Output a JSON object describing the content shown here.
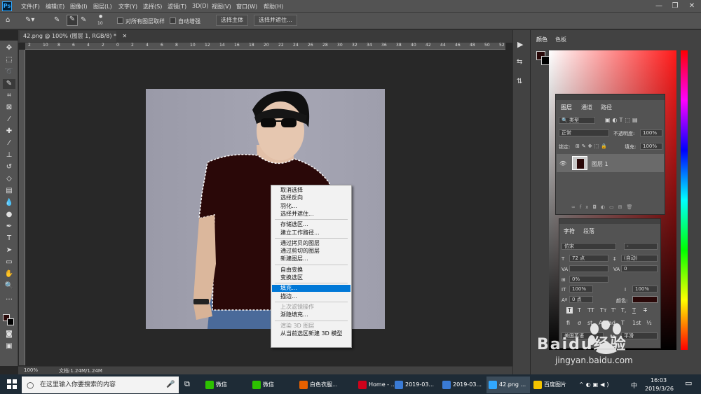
{
  "menubar": {
    "logo": "Ps",
    "items": [
      "文件(F)",
      "编辑(E)",
      "图像(I)",
      "图层(L)",
      "文字(Y)",
      "选择(S)",
      "滤镜(T)",
      "3D(D)",
      "视图(V)",
      "窗口(W)",
      "帮助(H)"
    ],
    "window_controls": [
      "—",
      "❐",
      "✕"
    ]
  },
  "options_bar": {
    "brush_size": "10",
    "sample_all_layers": "对所有图层取样",
    "auto_enhance": "自动增强",
    "select_subject": "选择主体",
    "select_and_mask": "选择并遮住..."
  },
  "document": {
    "tab_title": "42.png @ 100% (图层 1, RGB/8) *",
    "tab_close": "✕",
    "ruler_ticks": [
      "2",
      "10",
      "8",
      "6",
      "4",
      "2",
      "0",
      "2",
      "4",
      "6",
      "8",
      "10",
      "12",
      "14",
      "16",
      "18",
      "20",
      "22",
      "24",
      "26",
      "28",
      "30",
      "32",
      "34",
      "36",
      "38",
      "40",
      "42",
      "44",
      "46",
      "48",
      "50",
      "52"
    ],
    "zoom": "100%",
    "doc_info": "文档:1.24M/1.24M"
  },
  "context_menu": {
    "groups": [
      [
        {
          "label": "取消选择",
          "disabled": false
        },
        {
          "label": "选择反向",
          "disabled": false
        },
        {
          "label": "羽化...",
          "disabled": false
        },
        {
          "label": "选择并遮住...",
          "disabled": false
        }
      ],
      [
        {
          "label": "存储选区...",
          "disabled": false
        },
        {
          "label": "建立工作路径...",
          "disabled": false
        }
      ],
      [
        {
          "label": "通过拷贝的图层",
          "disabled": false
        },
        {
          "label": "通过剪切的图层",
          "disabled": false
        },
        {
          "label": "新建图层...",
          "disabled": false
        }
      ],
      [
        {
          "label": "自由变换",
          "disabled": false
        },
        {
          "label": "变换选区",
          "disabled": false
        }
      ],
      [
        {
          "label": "填充...",
          "disabled": false,
          "selected": true
        },
        {
          "label": "描边...",
          "disabled": false
        }
      ],
      [
        {
          "label": "上次滤镜操作",
          "disabled": true
        },
        {
          "label": "渐隐填充...",
          "disabled": false
        }
      ],
      [
        {
          "label": "渲染 3D 图层",
          "disabled": true
        },
        {
          "label": "从当前选区新建 3D 模型",
          "disabled": false
        }
      ]
    ]
  },
  "color_panel": {
    "tabs": [
      "颜色",
      "色板"
    ],
    "foreground": "#2a0a0a",
    "background": "#000000"
  },
  "layers_panel": {
    "tabs": [
      "图层",
      "通道",
      "路径"
    ],
    "filter": "类型",
    "blend_mode": "正常",
    "opacity_label": "不透明度:",
    "opacity": "100%",
    "lock_label": "锁定:",
    "fill_label": "填充:",
    "fill": "100%",
    "layer_name": "图层 1"
  },
  "character_panel": {
    "tabs": [
      "字符",
      "段落"
    ],
    "font_family": "仿宋",
    "font_style": "-",
    "font_size": "72 点",
    "leading": "(自动)",
    "kerning": "",
    "tracking": "0",
    "scale": "0%",
    "vscale": "100%",
    "hscale": "100%",
    "baseline": "0 点",
    "color_label": "颜色:",
    "language": "美国英语",
    "aa": "平滑",
    "type_buttons": [
      "T",
      "T",
      "TT",
      "Tт",
      "T'",
      "T,",
      "T",
      "T"
    ],
    "ot_buttons": [
      "fi",
      "ơ",
      "st",
      "A",
      "ad",
      "T",
      "1st",
      "½"
    ]
  },
  "taskbar": {
    "search_placeholder": "在这里输入你要搜索的内容",
    "apps": [
      {
        "label": "微信",
        "color": "#2dc100"
      },
      {
        "label": "微信",
        "color": "#2dc100"
      },
      {
        "label": "白色衣服...",
        "color": "#e66000"
      },
      {
        "label": "Home - ...",
        "color": "#d0021b"
      },
      {
        "label": "2019-03...",
        "color": "#3a7bd5"
      },
      {
        "label": "2019-03...",
        "color": "#3a7bd5"
      },
      {
        "label": "42.png ...",
        "color": "#31a8ff"
      },
      {
        "label": "百度图片",
        "color": "#f5c400"
      }
    ],
    "time": "16:03",
    "date": "2019/3/26",
    "ime": "中"
  },
  "watermark": {
    "text": "Baidu经验",
    "sub": "jingyan.baidu.com"
  }
}
